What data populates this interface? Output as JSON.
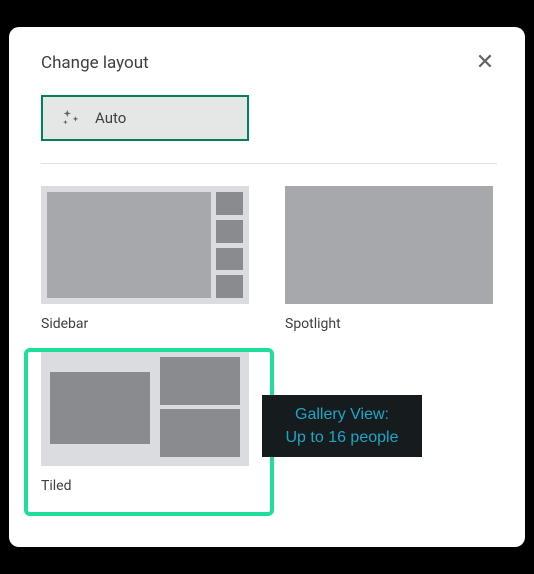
{
  "dialog": {
    "title": "Change layout"
  },
  "auto": {
    "label": "Auto"
  },
  "options": {
    "sidebar": {
      "label": "Sidebar"
    },
    "spotlight": {
      "label": "Spotlight"
    },
    "tiled": {
      "label": "Tiled"
    }
  },
  "tooltip": {
    "line1": "Gallery View:",
    "line2": "Up to 16 people"
  }
}
